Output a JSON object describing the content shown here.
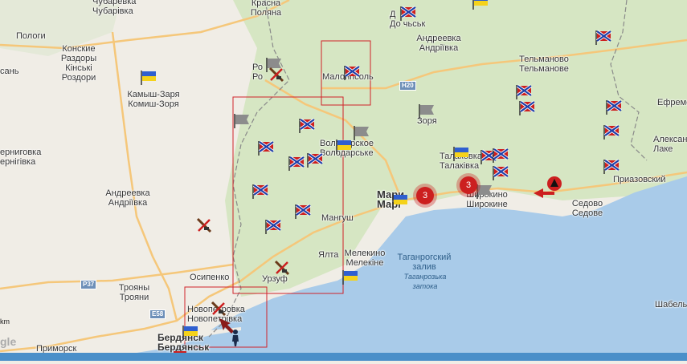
{
  "map": {
    "colors": {
      "land": "#f0ede6",
      "green": "#d6e6c3",
      "sea": "#a9cbe9",
      "road": "#f5c77a",
      "border": "#888888",
      "rect": "#d0232a"
    },
    "places": {
      "chubarevka": "Чубаревка\nЧубарівка",
      "polohi": "Пологи",
      "konskie": "Конские\nРаздоры\nКінські\nРоздори",
      "zaitsevo": "сань",
      "krasnaya": "Красна\nПоляна",
      "dokuchaevsk": "Д\nДо чьськ",
      "andreevka_n": "Андреевка\nАндріївка",
      "telmanovo": "Тельманово\nТельманове",
      "efremovka": "Ефремо",
      "kamysh": "Камыш-Заря\nКомиш-Зоря",
      "rozovka": "Ро\nРо",
      "malonikolskoye": "Малонпсоль",
      "zorya": "Зоря",
      "volodarskoye": "Володарское\nВолодарське",
      "berniggovka": "ерниговка\nернігівка",
      "andreevka_w": "Андреевка\nАндріївка",
      "talakovka": "Талаковка\nТалаківка",
      "aleksandrovka": "Алексан\nЛаке",
      "prizovsky": "Приазовский",
      "mariupol": "Мари\nМарі",
      "shirokino": "Широкино\nШирокине",
      "sedovo": "Седово\nСедове",
      "mangush": "Мангуш",
      "yalta": "Ялта",
      "melekino": "Мелекино\nМелекіне",
      "osipenko": "Осипенко",
      "troyany": "Трояны\nТрояни",
      "urzuf": "Урзуф",
      "novopetrovka": "Новопетровка\nНовопетрівка",
      "berdyansk": "Бердянск\nБердянськ",
      "primorsk": "Приморск",
      "shabel": "Шабель"
    },
    "sea": {
      "ru": "Таганрогский\nзалив",
      "ua": "Таганрозька\nзатока"
    },
    "roads": {
      "h20": "H20",
      "p37": "P37",
      "e58": "E58"
    },
    "clusters": {
      "a": "3",
      "b": "3"
    },
    "scale": "km",
    "google": "gle"
  }
}
